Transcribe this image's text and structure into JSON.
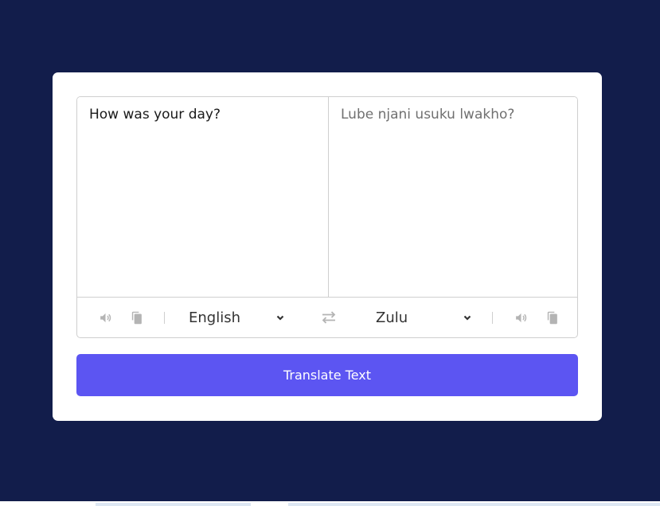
{
  "source": {
    "text": "How was your day?",
    "language": "English"
  },
  "target": {
    "text": "Lube njani usuku lwakho?",
    "language": "Zulu"
  },
  "translate_button_label": "Translate Text",
  "icons": {
    "speak": "volume-icon",
    "copy": "copy-icon",
    "exchange": "exchange-icon",
    "dropdown": "chevron-down-icon"
  },
  "colors": {
    "page_background": "#121d4b",
    "card_background": "#ffffff",
    "button_background": "#5c55f2",
    "icon_color": "#b4b4b4"
  }
}
